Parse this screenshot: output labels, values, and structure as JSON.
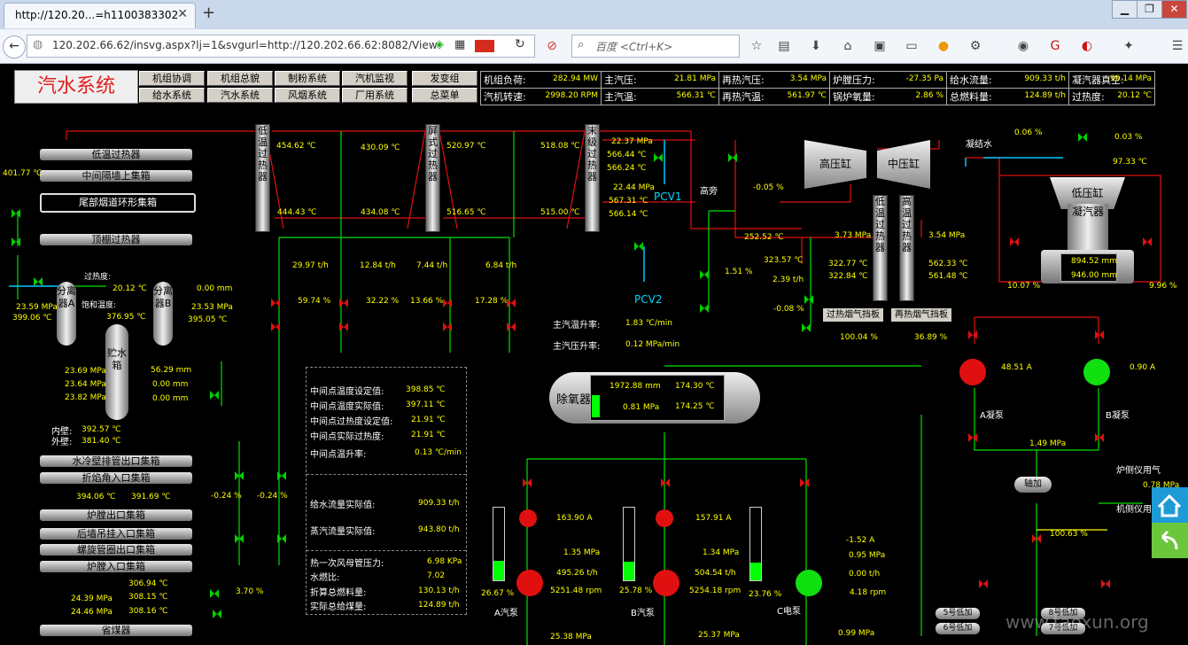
{
  "browser": {
    "tab_title": "http://120.20...=h1100383302",
    "url": "120.202.66.62/insvg.aspx?lj=1&svgurl=http://120.202.66.62:8082/View",
    "search_placeholder": "百度 <Ctrl+K>"
  },
  "title": "汽水系统",
  "menu": [
    [
      "机组协调",
      "机组总貌",
      "制粉系统",
      "汽机监视",
      "发变组"
    ],
    [
      "给水系统",
      "汽水系统",
      "风烟系统",
      "厂用系统",
      "总菜单"
    ]
  ],
  "stats": [
    [
      {
        "l": "机组负荷:",
        "v": "282.94 MW"
      },
      {
        "l": "主汽压:",
        "v": "21.81 MPa"
      },
      {
        "l": "再热汽压:",
        "v": "3.54 MPa"
      },
      {
        "l": "炉膛压力:",
        "v": "-27.35 Pa"
      },
      {
        "l": "给水流量:",
        "v": "909.33 t/h"
      },
      {
        "l": "凝汽器真空:",
        "v": "-96.14 MPa"
      }
    ],
    [
      {
        "l": "汽机转速:",
        "v": "2998.20 RPM"
      },
      {
        "l": "主汽温:",
        "v": "566.31 ℃"
      },
      {
        "l": "再热汽温:",
        "v": "561.97 ℃"
      },
      {
        "l": "锅炉氧量:",
        "v": "2.86 %"
      },
      {
        "l": "总燃料量:",
        "v": "124.89 t/h"
      },
      {
        "l": "过热度:",
        "v": "20.12 ℃"
      }
    ]
  ],
  "headers_top": [
    "低温过热器",
    "中间隔墙上集箱",
    "尾部烟道环形集箱",
    "顶棚过热器"
  ],
  "headers_bottom": [
    "水冷壁排管出口集箱",
    "折焰角入口集箱",
    "炉膛出口集箱",
    "后墙吊挂入口集箱",
    "螺旋管圈出口集箱",
    "炉膛入口集箱",
    "省煤器"
  ],
  "tubes": {
    "low_sh": "低温过热器",
    "screen_sh": "屏式过热器",
    "final_sh": "末级过热器",
    "low_rh": "低温过热器",
    "high_rh": "高温过热器"
  },
  "separators": {
    "a": "分离器A",
    "b": "分离器B",
    "tank": "贮水箱"
  },
  "turbines": {
    "hp": "高压缸",
    "ip": "中压缸",
    "lp": "低压缸",
    "cond": "凝汽器",
    "cond_water": "凝结水",
    "deaerator": "除氧器",
    "heater": "轴加"
  },
  "labels": {
    "pcv1": "PCV1",
    "pcv2": "PCV2",
    "hp_bypass": "高旁",
    "main_temp_rate": "主汽温升率:",
    "main_temp_rate_v": "1.83 ℃/min",
    "main_press_rate": "主汽压升率:",
    "main_press_rate_v": "0.12 MPa/min",
    "sh_baffle": "过热烟气挡板",
    "rh_baffle": "再热烟气挡板",
    "pump_a": "A凝泵",
    "pump_b": "B凝泵",
    "fp_a": "A汽泵",
    "fp_b": "B汽泵",
    "fp_c": "C电泵",
    "furnace_air": "炉侧仪用气",
    "machine_air": "机侧仪用",
    "inner": "内壁:",
    "outer": "外壁:",
    "superheat": "过热度:",
    "sat_temp": "饱和温度:",
    "h5": "5号低加",
    "h6": "6号低加",
    "h8": "8号低加",
    "h7": "7号低加"
  },
  "values": {
    "v401": "401.77 ℃",
    "v1": "454.62 ℃",
    "v2": "430.09 ℃",
    "v3": "444.43 ℃",
    "v4": "434.08 ℃",
    "v5": "520.97 ℃",
    "v6": "518.08 ℃",
    "v7": "516.65 ℃",
    "v8": "515.00 ℃",
    "m1": "22.37 MPa",
    "m2": "566.44 ℃",
    "m3": "566.24 ℃",
    "m4": "22.44 MPa",
    "m5": "567.31 ℃",
    "m6": "566.14 ℃",
    "f1": "29.97 t/h",
    "f2": "12.84 t/h",
    "f3": "7.44 t/h",
    "f4": "6.84 t/h",
    "p1": "59.74 %",
    "p2": "32.22 %",
    "p3": "13.66 %",
    "p4": "17.28 %",
    "sh": "20.12 ℃",
    "zero": "0.00 mm",
    "sat": "376.95 ℃",
    "sa1": "23.59 MPa",
    "sa2": "399.06 ℃",
    "sb1": "23.53 MPa",
    "sb2": "395.05 ℃",
    "t1": "23.69 MPa",
    "t2": "23.64 MPa",
    "t3": "23.82 MPa",
    "w1": "56.29 mm",
    "w2": "0.00 mm",
    "w3": "0.00 mm",
    "inner": "392.57 ℃",
    "outer": "381.40 ℃",
    "bp1": "-0.05 %",
    "bp2": "252.52 ℃",
    "bp3": "323.57 ℃",
    "bp4": "2.39 t/h",
    "bp5": "1.51 %",
    "bp6": "-0.08 %",
    "rh1": "3.73 MPa",
    "rh2": "322.77 ℃",
    "rh3": "322.84 ℃",
    "rh4": "3.54 MPa",
    "rh5": "562.33 ℃",
    "rh6": "561.48 ℃",
    "ba1": "100.04 %",
    "ba2": "36.89 %",
    "c1": "0.06 %",
    "c2": "0.03 %",
    "c3": "97.33 ℃",
    "c4": "894.52 mm",
    "c5": "946.00 mm",
    "c6": "10.07 %",
    "c7": "9.96 %",
    "pa": "48.51 A",
    "pb": "0.90 A",
    "pp": "1.49 MPa",
    "air1": "0.78 MPa",
    "ha": "100.63 %",
    "da1": "1972.88 mm",
    "da2": "174.30 ℃",
    "da3": "0.81 MPa",
    "da4": "174.25 ℃",
    "fa1": "163.90 A",
    "fa2": "1.35 MPa",
    "fa3": "495.26 t/h",
    "fa4": "5251.48 rpm",
    "fa5": "26.67 %",
    "fb1": "157.91 A",
    "fb2": "1.34 MPa",
    "fb3": "504.54 t/h",
    "fb4": "5254.18 rpm",
    "fb5": "25.78 %",
    "fc1": "-1.52 A",
    "fc2": "0.95 MPa",
    "fc3": "0.00 t/h",
    "fc4": "4.18 rpm",
    "fc5": "23.76 %",
    "d1": "-0.24 %",
    "d2": "-0.24 %",
    "d3": "3.70 %",
    "e1": "24.39 MPa",
    "e2": "24.46 MPa",
    "e3": "306.94 ℃",
    "e4": "308.15 ℃",
    "e5": "308.16 ℃",
    "g1": "394.06 ℃",
    "g2": "391.69 ℃",
    "fw": "25.38 MPa",
    "fw2": "25.37 MPa",
    "fw3": "0.99 MPa"
  },
  "panel": {
    "r1": "中间点温度设定值:",
    "r1v": "398.85 ℃",
    "r2": "中间点温度实际值:",
    "r2v": "397.11 ℃",
    "r3": "中间点过热度设定值:",
    "r3v": "21.91 ℃",
    "r4": "中间点实际过热度:",
    "r4v": "21.91 ℃",
    "r5": "中间点温升率:",
    "r5v": "0.13 ℃/min",
    "r6": "给水流量实际值:",
    "r6v": "909.33 t/h",
    "r7": "蒸汽流量实际值:",
    "r7v": "943.80 t/h",
    "r8": "热一次风母管压力:",
    "r8v": "6.98 KPa",
    "r9": "水燃比:",
    "r9v": "7.02",
    "r10": "折算总燃料量:",
    "r10v": "130.13 t/h",
    "r11": "实际总给煤量:",
    "r11v": "124.89 t/h"
  },
  "colors": {
    "pipe_red": "#e01010",
    "pipe_green": "#00e000",
    "pipe_cyan": "#00c8ff",
    "value": "#ffff00"
  },
  "watermark": "www.taoxun.org"
}
